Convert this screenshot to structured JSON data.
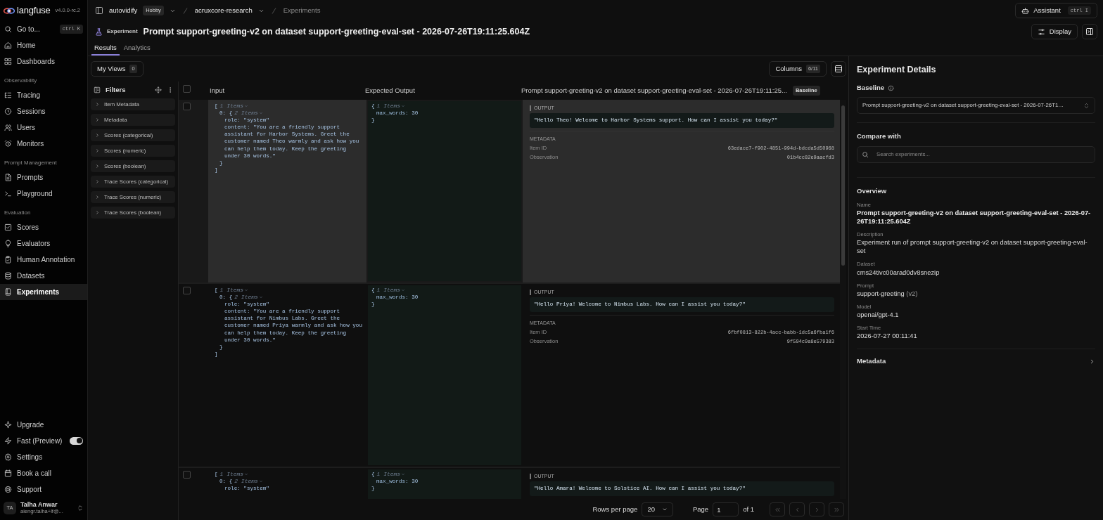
{
  "app": {
    "logo": "langfuse",
    "version": "v4.0.0-rc.2"
  },
  "breadcrumbs": [
    {
      "label": "autovidify",
      "badge": "Hobby",
      "dropdown": true
    },
    {
      "label": "acruxcore-research",
      "dropdown": true
    },
    {
      "label": "Experiments",
      "dropdown": false
    }
  ],
  "assistant": {
    "label": "Assistant",
    "shortcut": "ctrl I"
  },
  "sidebar": {
    "search": {
      "label": "Go to...",
      "shortcut": "ctrl K"
    },
    "sections": [
      {
        "items": [
          {
            "label": "Home",
            "selected": false
          },
          {
            "label": "Dashboards",
            "selected": false
          }
        ]
      },
      {
        "title": "Observability",
        "items": [
          {
            "label": "Tracing",
            "selected": false
          },
          {
            "label": "Sessions",
            "selected": false
          },
          {
            "label": "Users",
            "selected": false
          },
          {
            "label": "Monitors",
            "selected": false
          }
        ]
      },
      {
        "title": "Prompt Management",
        "items": [
          {
            "label": "Prompts",
            "selected": false
          },
          {
            "label": "Playground",
            "selected": false
          }
        ]
      },
      {
        "title": "Evaluation",
        "items": [
          {
            "label": "Scores",
            "selected": false
          },
          {
            "label": "Evaluators",
            "selected": false
          },
          {
            "label": "Human Annotation",
            "selected": false
          },
          {
            "label": "Datasets",
            "selected": false
          },
          {
            "label": "Experiments",
            "selected": true
          }
        ]
      }
    ],
    "bottom": [
      {
        "label": "Upgrade",
        "kind": "link"
      },
      {
        "label": "Fast (Preview)",
        "kind": "toggle",
        "on": true
      },
      {
        "label": "Settings",
        "kind": "link"
      },
      {
        "label": "Book a call",
        "kind": "link"
      },
      {
        "label": "Support",
        "kind": "link"
      }
    ],
    "user": {
      "initials": "TA",
      "name": "Talha Anwar",
      "email": "aiengr.talha+lf@..."
    }
  },
  "page": {
    "kind_label": "Experiment",
    "title": "Prompt support-greeting-v2 on dataset support-greeting-eval-set - 2026-07-26T19:11:25.604Z",
    "display_button": "Display"
  },
  "tabs": [
    {
      "label": "Results",
      "selected": true
    },
    {
      "label": "Analytics",
      "selected": false
    }
  ],
  "toolbar": {
    "views": {
      "label": "My Views",
      "count": "0"
    },
    "columns": {
      "label": "Columns",
      "count": "6/11"
    }
  },
  "filters": {
    "title": "Filters",
    "items": [
      {
        "label": "Item Metadata",
        "expanded": false
      },
      {
        "label": "Metadata",
        "expanded": false
      },
      {
        "label": "Scores (categorical)",
        "expanded": false
      },
      {
        "label": "Scores (numeric)",
        "expanded": false
      },
      {
        "label": "Scores (boolean)",
        "expanded": false
      },
      {
        "label": "Trace Scores (categorical)",
        "expanded": false
      },
      {
        "label": "Trace Scores (numeric)",
        "expanded": false
      },
      {
        "label": "Trace Scores (boolean)",
        "expanded": false
      }
    ]
  },
  "table": {
    "select_all": {
      "checked": false
    },
    "columns": [
      {
        "label": "Input"
      },
      {
        "label": "Expected Output"
      },
      {
        "label": "Prompt support-greeting-v2 on dataset support-greeting-eval-set - 2026-07-26T19:11:25...",
        "badge": "Baseline"
      }
    ],
    "rows": [
      {
        "checked": false,
        "highlighted": true,
        "input": {
          "open": "[",
          "count": "1 Items",
          "items": [
            {
              "key": "0:",
              "open": "{",
              "count": "2 Items",
              "fields": [
                {
                  "key": "role:",
                  "value": "\"system\""
                },
                {
                  "key": "content:",
                  "value": "\"You are a friendly support assistant for Harbor Systems. Greet the customer named Theo warmly and ask how you can help them today. Keep the greeting under 30 words.\""
                }
              ],
              "close": "}"
            }
          ],
          "close": "]"
        },
        "expected": {
          "open": "{",
          "count": "1 Items",
          "fields": [
            {
              "key": "max_words:",
              "value": "30"
            }
          ],
          "close": "}"
        },
        "output": {
          "label": "OUTPUT",
          "text": "\"Hello Theo! Welcome to Harbor Systems support. How can I assist you today?\"",
          "metadata": {
            "label": "METADATA",
            "fields": [
              {
                "key": "Item ID",
                "value": "63edace7-f902-4851-994d-bdcda5d50968"
              },
              {
                "key": "Observation",
                "value": "01b4cc82e9aacfd3"
              }
            ]
          }
        }
      },
      {
        "checked": false,
        "highlighted": false,
        "input": {
          "open": "[",
          "count": "1 Items",
          "items": [
            {
              "key": "0:",
              "open": "{",
              "count": "2 Items",
              "fields": [
                {
                  "key": "role:",
                  "value": "\"system\""
                },
                {
                  "key": "content:",
                  "value": "\"You are a friendly support assistant for Nimbus Labs. Greet the customer named Priya warmly and ask how you can help them today. Keep the greeting under 30 words.\""
                }
              ],
              "close": "}"
            }
          ],
          "close": "]"
        },
        "expected": {
          "open": "{",
          "count": "1 Items",
          "fields": [
            {
              "key": "max_words:",
              "value": "30"
            }
          ],
          "close": "}"
        },
        "output": {
          "label": "OUTPUT",
          "text": "\"Hello Priya! Welcome to Nimbus Labs. How can I assist you today?\"",
          "metadata": {
            "label": "METADATA",
            "fields": [
              {
                "key": "Item ID",
                "value": "6fbf0813-822b-4acc-babb-1dc5a6fba1f6"
              },
              {
                "key": "Observation",
                "value": "9f594c9a8e579383"
              }
            ]
          }
        }
      },
      {
        "checked": false,
        "highlighted": false,
        "input": {
          "open": "[",
          "count": "1 Items",
          "items": [
            {
              "key": "0:",
              "open": "{",
              "count": "2 Items",
              "fields": [
                {
                  "key": "role:",
                  "value": "\"system\""
                }
              ]
            }
          ]
        },
        "expected": {
          "open": "{",
          "count": "1 Items",
          "fields": [
            {
              "key": "max_words:",
              "value": "30"
            }
          ],
          "close": "}"
        },
        "output": {
          "label": "OUTPUT",
          "text": "\"Hello Amara! Welcome to Solstice AI. How can I assist you today?\""
        }
      }
    ]
  },
  "pagination": {
    "rows_label": "Rows per page",
    "rows_value": "20",
    "page_label": "Page",
    "page_value": "1",
    "of_label": "of 1"
  },
  "details": {
    "title": "Experiment Details",
    "baseline": {
      "label": "Baseline",
      "value": "Prompt support-greeting-v2 on dataset support-greeting-eval-set - 2026-07-26T1…"
    },
    "compare": {
      "label": "Compare with",
      "placeholder": "Search experiments..."
    },
    "overview": {
      "title": "Overview",
      "fields": [
        {
          "label": "Name",
          "value": "Prompt support-greeting-v2 on dataset support-greeting-eval-set - 2026-07-26T19:11:25.604Z",
          "strong": true
        },
        {
          "label": "Description",
          "value": "Experiment run of prompt support-greeting-v2 on dataset support-greeting-eval-set",
          "strong": false
        },
        {
          "label": "Dataset",
          "value": "cms24tivc00arad0dv8snezip",
          "strong": false
        },
        {
          "label": "Prompt",
          "value": "support-greeting",
          "suffix": "(v2)",
          "strong": false
        },
        {
          "label": "Model",
          "value": "openai/gpt-4.1",
          "strong": false
        },
        {
          "label": "Start Time",
          "value": "2026-07-27 00:11:41",
          "strong": false
        }
      ]
    },
    "metadata_label": "Metadata"
  }
}
